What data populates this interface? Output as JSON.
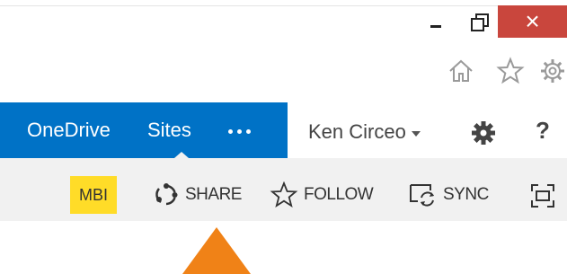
{
  "window_controls": {
    "minimize": "minimize",
    "maximize": "maximize",
    "close": "×"
  },
  "browser_icons": [
    "home-icon",
    "favorites-star-icon",
    "settings-gear-icon"
  ],
  "suite_bar": {
    "links": [
      "OneDrive",
      "Sites"
    ],
    "more": "...",
    "user_name": "Ken Circeo",
    "help": "?",
    "colors": {
      "brand_blue": "#0072c6"
    }
  },
  "command_bar": {
    "badge": "MBI",
    "share": "SHARE",
    "follow": "FOLLOW",
    "sync": "SYNC",
    "colors": {
      "badge_yellow": "#ffdc28",
      "arrow_orange": "#f08217"
    }
  }
}
